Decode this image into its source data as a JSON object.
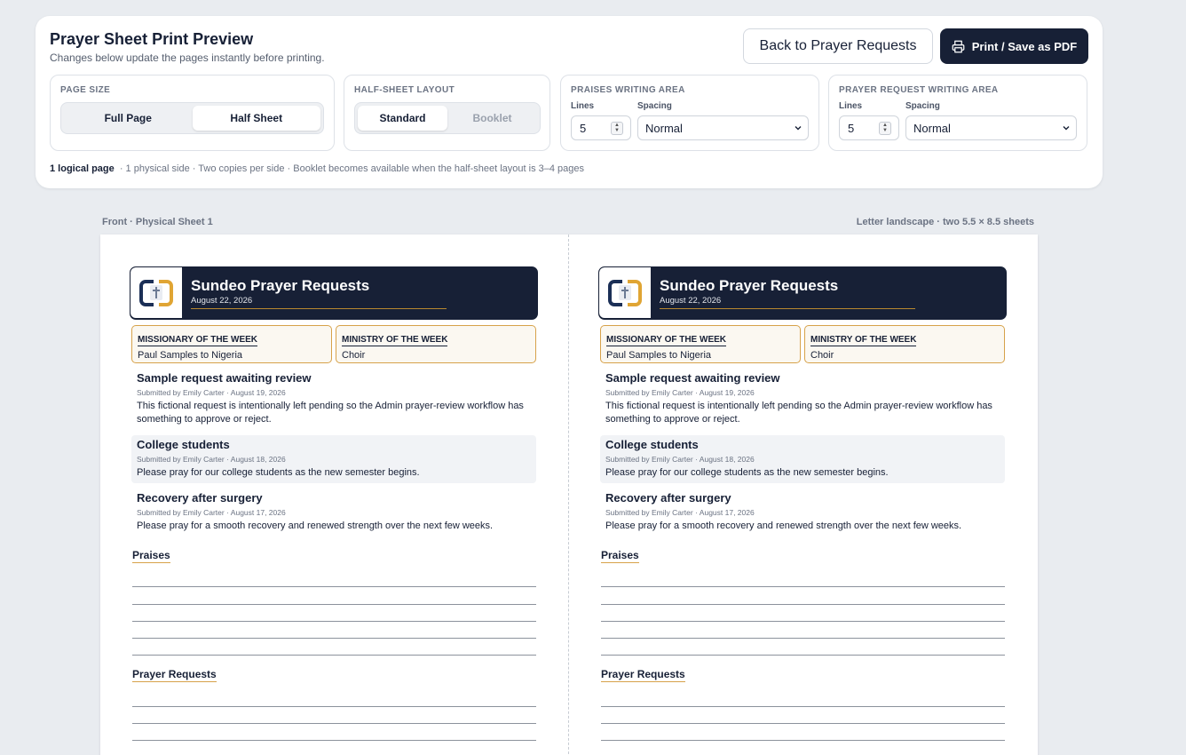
{
  "header": {
    "title": "Prayer Sheet Print Preview",
    "subtitle": "Changes below update the pages instantly before printing.",
    "back_button": "Back to Prayer Requests",
    "print_button": "Print / Save as PDF"
  },
  "page_size": {
    "label": "PAGE SIZE",
    "options": [
      "Full Page",
      "Half Sheet"
    ],
    "selected": "Half Sheet"
  },
  "half_sheet_layout": {
    "label": "HALF-SHEET LAYOUT",
    "options": [
      "Standard",
      "Booklet"
    ],
    "selected": "Standard"
  },
  "praises_area": {
    "label": "PRAISES WRITING AREA",
    "lines_label": "Lines",
    "lines_value": "5",
    "spacing_label": "Spacing",
    "spacing_value": "Normal"
  },
  "prayer_area": {
    "label": "PRAYER REQUEST WRITING AREA",
    "lines_label": "Lines",
    "lines_value": "5",
    "spacing_label": "Spacing",
    "spacing_value": "Normal"
  },
  "summary": {
    "bold": "1 logical page",
    "rest": "· 1 physical side · Two copies per side · Booklet becomes available when the half-sheet layout is 3–4 pages"
  },
  "preview": {
    "left_caption": "Front · Physical Sheet 1",
    "right_caption": "Letter landscape · two 5.5 × 8.5 sheets"
  },
  "sheet": {
    "title": "Sundeo Prayer Requests",
    "date": "August 22, 2026",
    "missionary_label": "MISSIONARY OF THE WEEK",
    "missionary_value": "Paul Samples to Nigeria",
    "ministry_label": "MINISTRY OF THE WEEK",
    "ministry_value": "Choir",
    "requests": [
      {
        "title": "Sample request awaiting review",
        "meta": "Submitted by Emily Carter · August 19, 2026",
        "body": "This fictional request is intentionally left pending so the Admin prayer-review workflow has something to approve or reject."
      },
      {
        "title": "College students",
        "meta": "Submitted by Emily Carter · August 18, 2026",
        "body": "Please pray for our college students as the new semester begins."
      },
      {
        "title": "Recovery after surgery",
        "meta": "Submitted by Emily Carter · August 17, 2026",
        "body": "Please pray for a smooth recovery and renewed strength over the next few weeks."
      }
    ],
    "praises_title": "Praises",
    "prayer_title": "Prayer Requests"
  },
  "colors": {
    "navy": "#172036",
    "gold": "#e0a534",
    "background": "#e9ecf0"
  }
}
